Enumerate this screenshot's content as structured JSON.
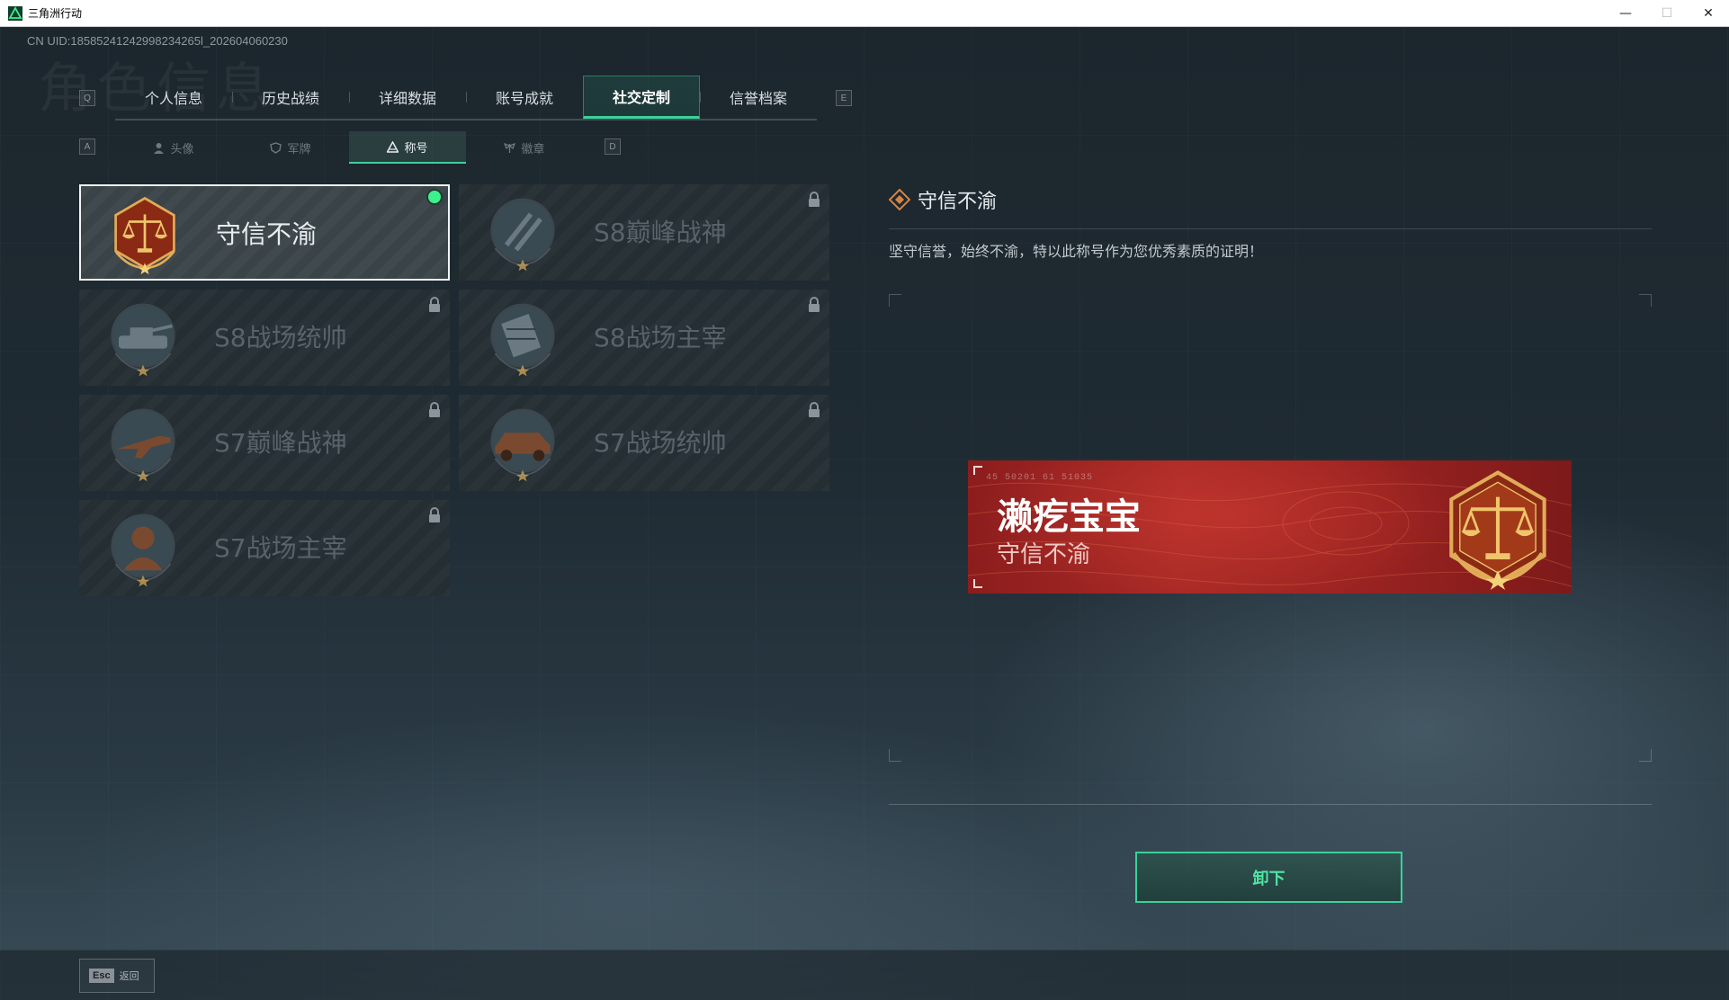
{
  "window": {
    "title": "三角洲行动",
    "minimize_glyph": "—",
    "maximize_glyph": "☐",
    "close_glyph": "✕"
  },
  "uid": "CN UID:18585241242998234265l_202604060230",
  "ghost_heading": "角色信息",
  "keys": {
    "prev_tab": "Q",
    "next_tab": "E",
    "prev_sub": "A",
    "next_sub": "D"
  },
  "main_tabs": [
    {
      "label": "个人信息"
    },
    {
      "label": "历史战绩"
    },
    {
      "label": "详细数据"
    },
    {
      "label": "账号成就"
    },
    {
      "label": "社交定制",
      "active": true
    },
    {
      "label": "信誉档案"
    }
  ],
  "sub_tabs": [
    {
      "label": "头像",
      "icon": "person-icon"
    },
    {
      "label": "军牌",
      "icon": "shield-icon"
    },
    {
      "label": "称号",
      "icon": "triangle-icon",
      "active": true
    },
    {
      "label": "徽章",
      "icon": "wings-icon"
    }
  ],
  "titles": [
    {
      "label": "守信不渝",
      "emblem": "scales-emblem-icon",
      "selected": true,
      "equipped": true,
      "locked": false
    },
    {
      "label": "S8巅峰战神",
      "emblem": "slash-emblem-icon",
      "locked": true
    },
    {
      "label": "S8战场统帅",
      "emblem": "tank-emblem-icon",
      "locked": true
    },
    {
      "label": "S8战场主宰",
      "emblem": "rocket-launcher-emblem-icon",
      "locked": true
    },
    {
      "label": "S7巅峰战神",
      "emblem": "rifle-emblem-icon",
      "locked": true
    },
    {
      "label": "S7战场统帅",
      "emblem": "vehicle-emblem-icon",
      "locked": true
    },
    {
      "label": "S7战场主宰",
      "emblem": "soldier-emblem-icon",
      "locked": true
    }
  ],
  "detail": {
    "title": "守信不渝",
    "description": "坚守信誉，始终不渝，特以此称号作为您优秀素质的证明！"
  },
  "banner": {
    "player_name": "濑疙宝宝",
    "title": "守信不渝",
    "code": "45 50201  61 51035"
  },
  "unequip_button": "卸下",
  "esc": {
    "key": "Esc",
    "label": "返回"
  },
  "colors": {
    "accent": "#3bd19a",
    "equipped_dot": "#3ef08d",
    "banner_red": "#a82a26",
    "emblem_gold": "#d9a24a"
  }
}
